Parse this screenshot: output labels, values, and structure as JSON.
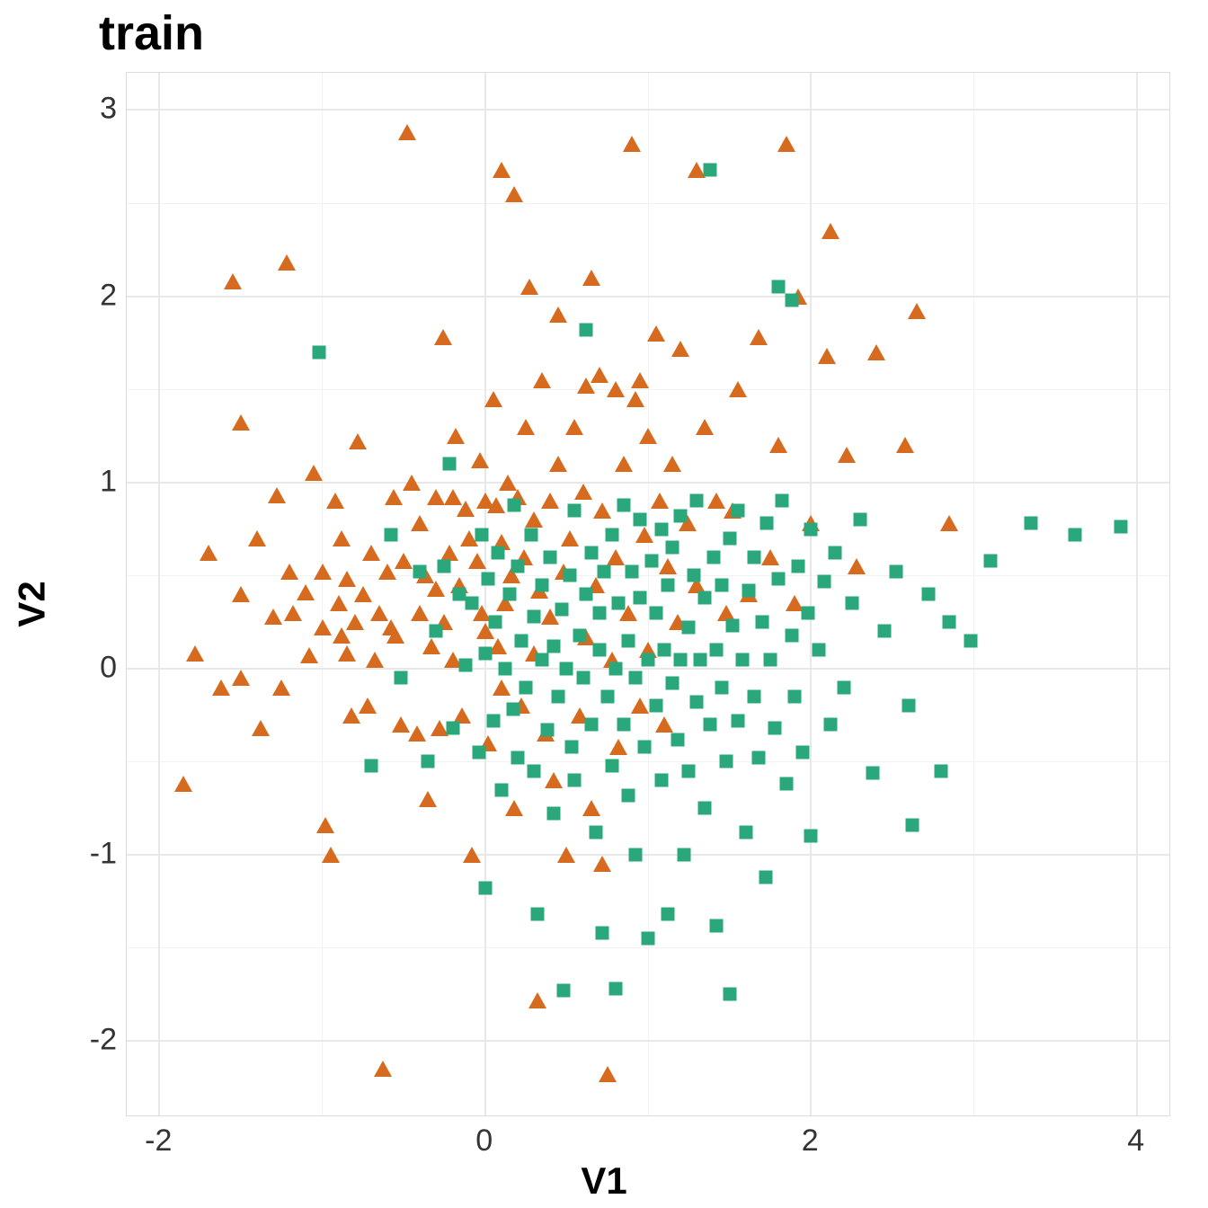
{
  "chart_data": {
    "type": "scatter",
    "title": "train",
    "xlabel": "V1",
    "ylabel": "V2",
    "xlim": [
      -2.2,
      4.2
    ],
    "ylim": [
      -2.4,
      3.2
    ],
    "xticks": [
      -2,
      0,
      2,
      4
    ],
    "yticks": [
      -2,
      -1,
      0,
      1,
      2,
      3
    ],
    "colors": {
      "triangle": "#d66a1f",
      "square": "#2aa77b"
    },
    "series": [
      {
        "name": "triangle",
        "shape": "triangle",
        "points": [
          [
            -1.85,
            -0.62
          ],
          [
            -1.78,
            0.08
          ],
          [
            -1.7,
            0.62
          ],
          [
            -1.62,
            -0.1
          ],
          [
            -1.55,
            2.08
          ],
          [
            -1.5,
            -0.05
          ],
          [
            -1.5,
            0.4
          ],
          [
            -1.5,
            1.32
          ],
          [
            -1.4,
            0.7
          ],
          [
            -1.38,
            -0.32
          ],
          [
            -1.3,
            0.28
          ],
          [
            -1.28,
            0.93
          ],
          [
            -1.25,
            -0.1
          ],
          [
            -1.22,
            2.18
          ],
          [
            -1.2,
            0.52
          ],
          [
            -1.18,
            0.3
          ],
          [
            -1.1,
            0.41
          ],
          [
            -1.08,
            0.07
          ],
          [
            -1.05,
            1.05
          ],
          [
            -1.0,
            0.22
          ],
          [
            -1.0,
            0.52
          ],
          [
            -0.98,
            -0.84
          ],
          [
            -0.95,
            -1.0
          ],
          [
            -0.92,
            0.9
          ],
          [
            -0.9,
            0.35
          ],
          [
            -0.88,
            0.18
          ],
          [
            -0.88,
            0.7
          ],
          [
            -0.85,
            0.08
          ],
          [
            -0.85,
            0.48
          ],
          [
            -0.82,
            -0.25
          ],
          [
            -0.8,
            0.25
          ],
          [
            -0.78,
            1.22
          ],
          [
            -0.75,
            0.4
          ],
          [
            -0.72,
            -0.2
          ],
          [
            -0.7,
            0.62
          ],
          [
            -0.68,
            0.05
          ],
          [
            -0.65,
            0.3
          ],
          [
            -0.63,
            -2.15
          ],
          [
            -0.6,
            0.52
          ],
          [
            -0.58,
            0.22
          ],
          [
            -0.56,
            0.92
          ],
          [
            -0.55,
            0.18
          ],
          [
            -0.52,
            -0.3
          ],
          [
            -0.5,
            0.58
          ],
          [
            -0.48,
            2.88
          ],
          [
            -0.45,
            1.0
          ],
          [
            -0.42,
            -0.35
          ],
          [
            -0.4,
            0.3
          ],
          [
            -0.4,
            0.78
          ],
          [
            -0.37,
            0.5
          ],
          [
            -0.35,
            -0.7
          ],
          [
            -0.33,
            0.12
          ],
          [
            -0.3,
            0.43
          ],
          [
            -0.3,
            0.92
          ],
          [
            -0.28,
            -0.32
          ],
          [
            -0.26,
            1.78
          ],
          [
            -0.25,
            0.25
          ],
          [
            -0.22,
            0.62
          ],
          [
            -0.2,
            0.05
          ],
          [
            -0.2,
            0.92
          ],
          [
            -0.18,
            1.25
          ],
          [
            -0.16,
            0.45
          ],
          [
            -0.14,
            -0.25
          ],
          [
            -0.12,
            0.86
          ],
          [
            -0.1,
            0.7
          ],
          [
            -0.08,
            -1.0
          ],
          [
            -0.05,
            0.58
          ],
          [
            -0.03,
            1.12
          ],
          [
            -0.02,
            0.3
          ],
          [
            0.0,
            0.9
          ],
          [
            0.0,
            0.2
          ],
          [
            0.02,
            -0.4
          ],
          [
            0.05,
            1.45
          ],
          [
            0.07,
            0.88
          ],
          [
            0.08,
            0.12
          ],
          [
            0.1,
            -0.1
          ],
          [
            0.1,
            0.68
          ],
          [
            0.1,
            2.68
          ],
          [
            0.12,
            0.35
          ],
          [
            0.14,
            1.0
          ],
          [
            0.16,
            0.5
          ],
          [
            0.18,
            -0.75
          ],
          [
            0.18,
            2.55
          ],
          [
            0.2,
            0.92
          ],
          [
            0.22,
            -0.2
          ],
          [
            0.24,
            0.6
          ],
          [
            0.25,
            1.3
          ],
          [
            0.27,
            2.05
          ],
          [
            0.3,
            0.08
          ],
          [
            0.3,
            0.8
          ],
          [
            0.32,
            -1.78
          ],
          [
            0.33,
            0.42
          ],
          [
            0.35,
            1.55
          ],
          [
            0.37,
            -0.35
          ],
          [
            0.4,
            0.28
          ],
          [
            0.4,
            0.9
          ],
          [
            0.42,
            -0.6
          ],
          [
            0.45,
            1.1
          ],
          [
            0.45,
            1.9
          ],
          [
            0.48,
            0.52
          ],
          [
            0.5,
            -1.0
          ],
          [
            0.52,
            0.7
          ],
          [
            0.55,
            1.3
          ],
          [
            0.58,
            -0.25
          ],
          [
            0.6,
            0.95
          ],
          [
            0.62,
            0.17
          ],
          [
            0.62,
            1.52
          ],
          [
            0.65,
            -0.75
          ],
          [
            0.65,
            2.1
          ],
          [
            0.68,
            0.45
          ],
          [
            0.7,
            1.58
          ],
          [
            0.72,
            -1.05
          ],
          [
            0.72,
            0.85
          ],
          [
            0.75,
            -2.18
          ],
          [
            0.78,
            0.05
          ],
          [
            0.8,
            0.6
          ],
          [
            0.8,
            1.5
          ],
          [
            0.82,
            -0.42
          ],
          [
            0.85,
            1.1
          ],
          [
            0.88,
            0.3
          ],
          [
            0.9,
            2.82
          ],
          [
            0.92,
            1.45
          ],
          [
            0.95,
            -0.2
          ],
          [
            0.95,
            1.55
          ],
          [
            0.98,
            0.72
          ],
          [
            1.0,
            0.1
          ],
          [
            1.0,
            1.25
          ],
          [
            1.05,
            1.8
          ],
          [
            1.07,
            0.9
          ],
          [
            1.1,
            -0.3
          ],
          [
            1.12,
            0.55
          ],
          [
            1.15,
            1.1
          ],
          [
            1.18,
            0.25
          ],
          [
            1.2,
            1.72
          ],
          [
            1.24,
            0.78
          ],
          [
            1.3,
            0.45
          ],
          [
            1.3,
            2.68
          ],
          [
            1.35,
            1.3
          ],
          [
            1.42,
            0.9
          ],
          [
            1.48,
            0.3
          ],
          [
            1.52,
            0.85
          ],
          [
            1.55,
            1.5
          ],
          [
            1.62,
            0.4
          ],
          [
            1.68,
            1.78
          ],
          [
            1.75,
            0.6
          ],
          [
            1.8,
            1.2
          ],
          [
            1.85,
            2.82
          ],
          [
            1.9,
            0.35
          ],
          [
            1.92,
            2.0
          ],
          [
            2.0,
            0.78
          ],
          [
            2.1,
            1.68
          ],
          [
            2.12,
            2.35
          ],
          [
            2.22,
            1.15
          ],
          [
            2.28,
            0.55
          ],
          [
            2.4,
            1.7
          ],
          [
            2.58,
            1.2
          ],
          [
            2.65,
            1.92
          ],
          [
            2.85,
            0.78
          ]
        ]
      },
      {
        "name": "square",
        "shape": "square",
        "points": [
          [
            -1.02,
            1.7
          ],
          [
            -0.7,
            -0.52
          ],
          [
            -0.58,
            0.72
          ],
          [
            -0.52,
            -0.05
          ],
          [
            -0.4,
            0.52
          ],
          [
            -0.35,
            -0.5
          ],
          [
            -0.3,
            0.2
          ],
          [
            -0.25,
            0.55
          ],
          [
            -0.22,
            1.1
          ],
          [
            -0.2,
            -0.32
          ],
          [
            -0.16,
            0.4
          ],
          [
            -0.12,
            0.02
          ],
          [
            -0.08,
            0.35
          ],
          [
            -0.04,
            -0.45
          ],
          [
            -0.02,
            0.72
          ],
          [
            0.0,
            -1.18
          ],
          [
            0.0,
            0.08
          ],
          [
            0.02,
            0.48
          ],
          [
            0.05,
            -0.28
          ],
          [
            0.06,
            0.25
          ],
          [
            0.08,
            0.62
          ],
          [
            0.1,
            -0.65
          ],
          [
            0.12,
            0.0
          ],
          [
            0.15,
            0.4
          ],
          [
            0.17,
            -0.22
          ],
          [
            0.18,
            0.88
          ],
          [
            0.2,
            -0.48
          ],
          [
            0.2,
            0.55
          ],
          [
            0.22,
            0.15
          ],
          [
            0.25,
            -0.1
          ],
          [
            0.28,
            0.72
          ],
          [
            0.3,
            -0.55
          ],
          [
            0.3,
            0.28
          ],
          [
            0.32,
            -1.32
          ],
          [
            0.35,
            0.05
          ],
          [
            0.35,
            0.45
          ],
          [
            0.38,
            -0.33
          ],
          [
            0.4,
            0.6
          ],
          [
            0.42,
            -0.78
          ],
          [
            0.42,
            0.12
          ],
          [
            0.45,
            -0.15
          ],
          [
            0.47,
            0.32
          ],
          [
            0.48,
            -1.73
          ],
          [
            0.5,
            0.0
          ],
          [
            0.52,
            0.5
          ],
          [
            0.53,
            -0.42
          ],
          [
            0.55,
            0.85
          ],
          [
            0.55,
            -0.6
          ],
          [
            0.58,
            0.18
          ],
          [
            0.6,
            -0.05
          ],
          [
            0.62,
            0.4
          ],
          [
            0.62,
            1.82
          ],
          [
            0.65,
            -0.3
          ],
          [
            0.65,
            0.62
          ],
          [
            0.68,
            -0.88
          ],
          [
            0.7,
            0.1
          ],
          [
            0.7,
            0.3
          ],
          [
            0.72,
            -1.42
          ],
          [
            0.73,
            0.52
          ],
          [
            0.75,
            -0.15
          ],
          [
            0.78,
            0.72
          ],
          [
            0.78,
            -0.52
          ],
          [
            0.8,
            -1.72
          ],
          [
            0.8,
            0.0
          ],
          [
            0.82,
            0.35
          ],
          [
            0.85,
            -0.3
          ],
          [
            0.85,
            0.88
          ],
          [
            0.88,
            -0.68
          ],
          [
            0.88,
            0.15
          ],
          [
            0.9,
            0.52
          ],
          [
            0.92,
            -1.0
          ],
          [
            0.92,
            -0.05
          ],
          [
            0.95,
            0.38
          ],
          [
            0.95,
            0.8
          ],
          [
            0.98,
            -0.42
          ],
          [
            1.0,
            -1.45
          ],
          [
            1.0,
            0.05
          ],
          [
            1.02,
            0.58
          ],
          [
            1.05,
            -0.2
          ],
          [
            1.05,
            0.3
          ],
          [
            1.08,
            0.75
          ],
          [
            1.08,
            -0.6
          ],
          [
            1.1,
            0.1
          ],
          [
            1.12,
            -1.32
          ],
          [
            1.12,
            0.45
          ],
          [
            1.15,
            -0.08
          ],
          [
            1.15,
            0.65
          ],
          [
            1.18,
            -0.38
          ],
          [
            1.2,
            0.05
          ],
          [
            1.2,
            0.82
          ],
          [
            1.22,
            -1.0
          ],
          [
            1.25,
            0.22
          ],
          [
            1.25,
            -0.55
          ],
          [
            1.28,
            0.5
          ],
          [
            1.3,
            -0.18
          ],
          [
            1.3,
            0.9
          ],
          [
            1.32,
            0.05
          ],
          [
            1.35,
            -0.75
          ],
          [
            1.35,
            0.38
          ],
          [
            1.38,
            -0.3
          ],
          [
            1.38,
            2.68
          ],
          [
            1.4,
            0.6
          ],
          [
            1.42,
            -1.38
          ],
          [
            1.42,
            0.1
          ],
          [
            1.45,
            -0.1
          ],
          [
            1.45,
            0.45
          ],
          [
            1.48,
            -0.5
          ],
          [
            1.5,
            0.7
          ],
          [
            1.5,
            -1.75
          ],
          [
            1.52,
            0.23
          ],
          [
            1.55,
            -0.28
          ],
          [
            1.55,
            0.85
          ],
          [
            1.58,
            0.05
          ],
          [
            1.6,
            -0.88
          ],
          [
            1.62,
            0.42
          ],
          [
            1.65,
            -0.15
          ],
          [
            1.65,
            0.6
          ],
          [
            1.68,
            -0.48
          ],
          [
            1.7,
            0.25
          ],
          [
            1.72,
            -1.12
          ],
          [
            1.73,
            0.78
          ],
          [
            1.75,
            0.05
          ],
          [
            1.78,
            -0.32
          ],
          [
            1.8,
            0.48
          ],
          [
            1.8,
            2.05
          ],
          [
            1.82,
            0.9
          ],
          [
            1.85,
            -0.62
          ],
          [
            1.88,
            0.18
          ],
          [
            1.88,
            1.98
          ],
          [
            1.9,
            -0.15
          ],
          [
            1.92,
            0.55
          ],
          [
            1.95,
            -0.45
          ],
          [
            1.98,
            0.3
          ],
          [
            2.0,
            0.75
          ],
          [
            2.0,
            -0.9
          ],
          [
            2.05,
            0.1
          ],
          [
            2.08,
            0.47
          ],
          [
            2.12,
            -0.3
          ],
          [
            2.15,
            0.62
          ],
          [
            2.2,
            -0.1
          ],
          [
            2.25,
            0.35
          ],
          [
            2.3,
            0.8
          ],
          [
            2.38,
            -0.56
          ],
          [
            2.45,
            0.2
          ],
          [
            2.52,
            0.52
          ],
          [
            2.6,
            -0.2
          ],
          [
            2.62,
            -0.84
          ],
          [
            2.72,
            0.4
          ],
          [
            2.8,
            -0.55
          ],
          [
            2.85,
            0.25
          ],
          [
            2.98,
            0.15
          ],
          [
            3.1,
            0.58
          ],
          [
            3.35,
            0.78
          ],
          [
            3.62,
            0.72
          ],
          [
            3.9,
            0.76
          ]
        ]
      }
    ]
  }
}
